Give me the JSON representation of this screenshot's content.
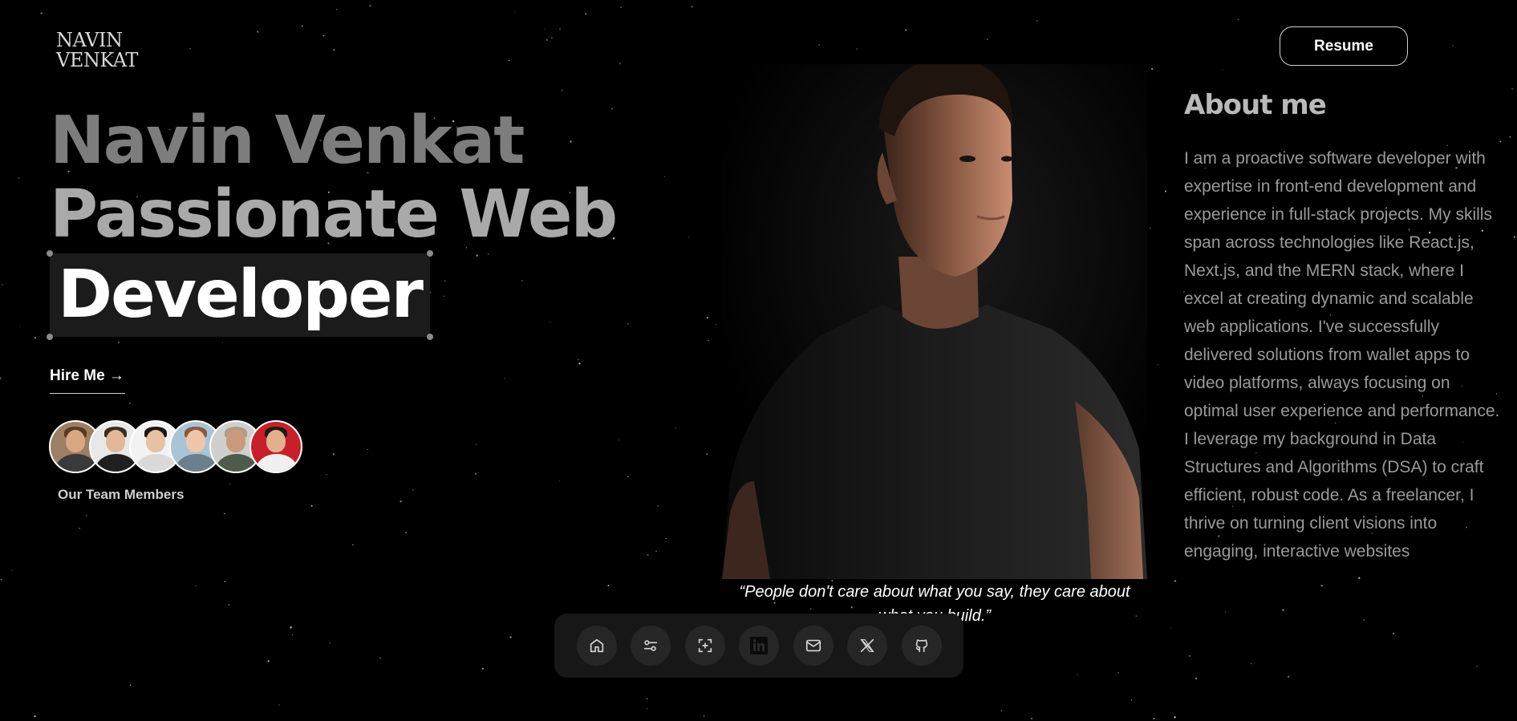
{
  "logo": {
    "line1": "NAVIN",
    "line2": "VENKAT"
  },
  "header": {
    "resume_label": "Resume"
  },
  "hero": {
    "line1": "Navin Venkat",
    "line2": "Passionate Web",
    "highlight": "Developer",
    "hire_label": "Hire Me →"
  },
  "team": {
    "label": "Our Team Members",
    "count": 6
  },
  "quote": {
    "text": "“People don't care about what you say, they care about what you build.”"
  },
  "dock": {
    "items": [
      {
        "name": "home-icon"
      },
      {
        "name": "sliders-icon"
      },
      {
        "name": "focus-icon"
      },
      {
        "name": "linkedin-icon"
      },
      {
        "name": "mail-icon"
      },
      {
        "name": "x-twitter-icon"
      },
      {
        "name": "github-icon"
      }
    ]
  },
  "about": {
    "title": "About me",
    "body": "I am a proactive software developer with expertise in front-end development and experience in full-stack projects. My skills span across technologies like React.js, Next.js, and the MERN stack, where I excel at creating dynamic and scalable web applications. I've successfully delivered solutions from wallet apps to video platforms, always focusing on optimal user experience and performance. I leverage my background in Data Structures and Algorithms (DSA) to craft efficient, robust code. As a freelancer, I thrive on turning client visions into engaging, interactive websites"
  },
  "colors": {
    "background": "#000000",
    "dock": "#171717",
    "dock_button": "#262626",
    "highlight_box": "#1b1b1b"
  }
}
